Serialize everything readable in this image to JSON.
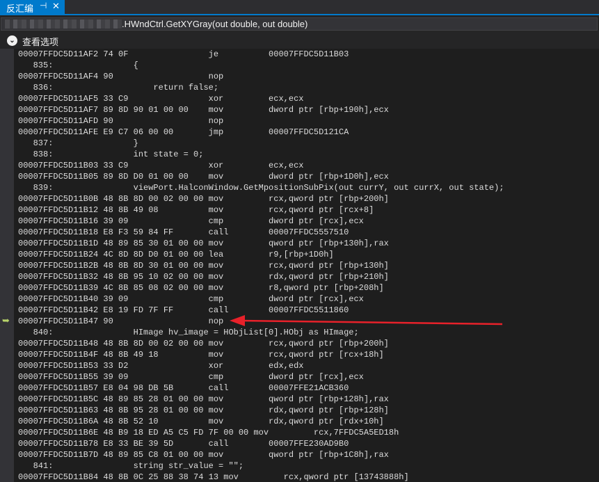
{
  "tab": {
    "title": "反汇编",
    "pin": "⊣",
    "close": "✕"
  },
  "address": {
    "method": ".HWndCtrl.GetXYGray(out double, out double)"
  },
  "view_options": {
    "label": "查看选项"
  },
  "lines": [
    "00007FFDC5D11AF2 74 0F                je          00007FFDC5D11B03",
    "   835:                {",
    "00007FFDC5D11AF4 90                   nop",
    "   836:                    return false;",
    "00007FFDC5D11AF5 33 C9                xor         ecx,ecx",
    "00007FFDC5D11AF7 89 8D 90 01 00 00    mov         dword ptr [rbp+190h],ecx",
    "00007FFDC5D11AFD 90                   nop",
    "00007FFDC5D11AFE E9 C7 06 00 00       jmp         00007FFDC5D121CA",
    "   837:                }",
    "   838:                int state = 0;",
    "00007FFDC5D11B03 33 C9                xor         ecx,ecx",
    "00007FFDC5D11B05 89 8D D0 01 00 00    mov         dword ptr [rbp+1D0h],ecx",
    "   839:                viewPort.HalconWindow.GetMpositionSubPix(out currY, out currX, out state);",
    "00007FFDC5D11B0B 48 8B 8D 00 02 00 00 mov         rcx,qword ptr [rbp+200h]",
    "00007FFDC5D11B12 48 8B 49 08          mov         rcx,qword ptr [rcx+8]",
    "00007FFDC5D11B16 39 09                cmp         dword ptr [rcx],ecx",
    "00007FFDC5D11B18 E8 F3 59 84 FF       call        00007FFDC5557510",
    "00007FFDC5D11B1D 48 89 85 30 01 00 00 mov         qword ptr [rbp+130h],rax",
    "00007FFDC5D11B24 4C 8D 8D D0 01 00 00 lea         r9,[rbp+1D0h]",
    "00007FFDC5D11B2B 48 8B 8D 30 01 00 00 mov         rcx,qword ptr [rbp+130h]",
    "00007FFDC5D11B32 48 8B 95 10 02 00 00 mov         rdx,qword ptr [rbp+210h]",
    "00007FFDC5D11B39 4C 8B 85 08 02 00 00 mov         r8,qword ptr [rbp+208h]",
    "00007FFDC5D11B40 39 09                cmp         dword ptr [rcx],ecx",
    "00007FFDC5D11B42 E8 19 FD 7F FF       call        00007FFDC5511860",
    "00007FFDC5D11B47 90                   nop",
    "   840:                HImage hv_image = HObjList[0].HObj as HImage;",
    "00007FFDC5D11B48 48 8B 8D 00 02 00 00 mov         rcx,qword ptr [rbp+200h]",
    "00007FFDC5D11B4F 48 8B 49 18          mov         rcx,qword ptr [rcx+18h]",
    "00007FFDC5D11B53 33 D2                xor         edx,edx",
    "00007FFDC5D11B55 39 09                cmp         dword ptr [rcx],ecx",
    "00007FFDC5D11B57 E8 04 98 DB 5B       call        00007FFE21ACB360",
    "00007FFDC5D11B5C 48 89 85 28 01 00 00 mov         qword ptr [rbp+128h],rax",
    "00007FFDC5D11B63 48 8B 95 28 01 00 00 mov         rdx,qword ptr [rbp+128h]",
    "00007FFDC5D11B6A 48 8B 52 10          mov         rdx,qword ptr [rdx+10h]",
    "00007FFDC5D11B6E 48 B9 18 ED A5 C5 FD 7F 00 00 mov         rcx,7FFDC5A5ED18h",
    "00007FFDC5D11B78 E8 33 BE 39 5D       call        00007FFE230AD9B0",
    "00007FFDC5D11B7D 48 89 85 C8 01 00 00 mov         qword ptr [rbp+1C8h],rax",
    "   841:                string str_value = \"\";",
    "00007FFDC5D11B84 48 8B 0C 25 88 38 74 13 mov         rcx,qword ptr [13743888h]"
  ]
}
